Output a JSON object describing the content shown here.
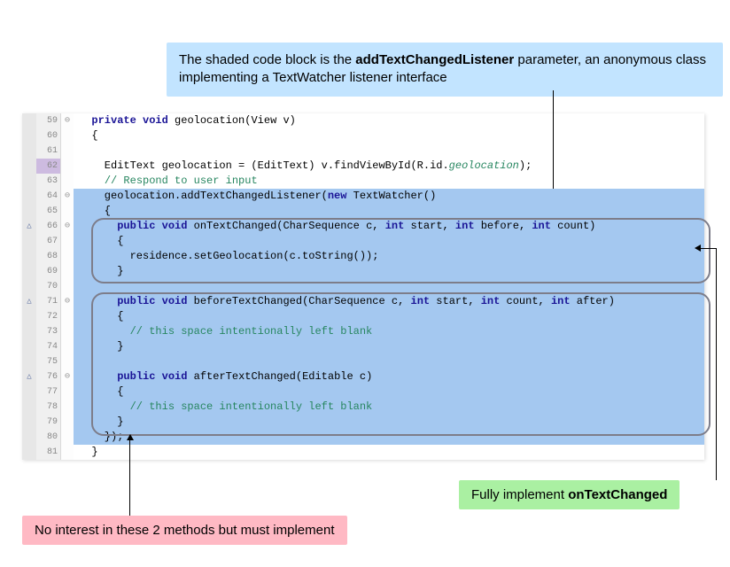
{
  "callout_top": {
    "pre": "The shaded code block is the ",
    "bold": "addTextChangedListener",
    "post": " parameter, an anonymous class implementing a TextWatcher listener interface"
  },
  "callout_green": {
    "pre": "Fully implement ",
    "bold": "onTextChanged"
  },
  "callout_pink": "No interest in these 2 methods but must implement",
  "lines": [
    {
      "num": "59",
      "ga": "",
      "gc": "⊖",
      "shaded": false,
      "hl": false,
      "segs": [
        [
          "",
          "  "
        ],
        [
          "kw",
          "private"
        ],
        [
          "",
          " "
        ],
        [
          "kw",
          "void"
        ],
        [
          "",
          " geolocation(View v)"
        ]
      ]
    },
    {
      "num": "60",
      "ga": "",
      "gc": "",
      "shaded": false,
      "hl": false,
      "segs": [
        [
          "",
          "  {"
        ]
      ]
    },
    {
      "num": "61",
      "ga": "",
      "gc": "",
      "shaded": false,
      "hl": false,
      "segs": [
        [
          "",
          ""
        ]
      ]
    },
    {
      "num": "62",
      "ga": "",
      "gc": "",
      "shaded": false,
      "hl": true,
      "segs": [
        [
          "",
          "    EditText geolocation = (EditText) v.findViewById(R.id."
        ],
        [
          "field",
          "geolocation"
        ],
        [
          "",
          ");"
        ]
      ]
    },
    {
      "num": "63",
      "ga": "",
      "gc": "",
      "shaded": false,
      "hl": false,
      "segs": [
        [
          "",
          "    "
        ],
        [
          "cm",
          "// Respond to user input"
        ]
      ]
    },
    {
      "num": "64",
      "ga": "",
      "gc": "⊖",
      "shaded": true,
      "hl": false,
      "segs": [
        [
          "",
          "    geolocation.addTextChangedListener("
        ],
        [
          "kw",
          "new"
        ],
        [
          "",
          " TextWatcher()"
        ]
      ]
    },
    {
      "num": "65",
      "ga": "",
      "gc": "",
      "shaded": true,
      "hl": false,
      "segs": [
        [
          "",
          "    {"
        ]
      ]
    },
    {
      "num": "66",
      "ga": "△",
      "gc": "⊖",
      "shaded": true,
      "hl": false,
      "segs": [
        [
          "",
          "      "
        ],
        [
          "kw",
          "public"
        ],
        [
          "",
          " "
        ],
        [
          "kw",
          "void"
        ],
        [
          "",
          " onTextChanged(CharSequence c, "
        ],
        [
          "kw",
          "int"
        ],
        [
          "",
          " start, "
        ],
        [
          "kw",
          "int"
        ],
        [
          "",
          " before, "
        ],
        [
          "kw",
          "int"
        ],
        [
          "",
          " count)"
        ]
      ]
    },
    {
      "num": "67",
      "ga": "",
      "gc": "",
      "shaded": true,
      "hl": false,
      "segs": [
        [
          "",
          "      {"
        ]
      ]
    },
    {
      "num": "68",
      "ga": "",
      "gc": "",
      "shaded": true,
      "hl": false,
      "segs": [
        [
          "",
          "        residence.setGeolocation(c.toString());"
        ]
      ]
    },
    {
      "num": "69",
      "ga": "",
      "gc": "",
      "shaded": true,
      "hl": false,
      "segs": [
        [
          "",
          "      }"
        ]
      ]
    },
    {
      "num": "70",
      "ga": "",
      "gc": "",
      "shaded": true,
      "hl": false,
      "segs": [
        [
          "",
          ""
        ]
      ]
    },
    {
      "num": "71",
      "ga": "△",
      "gc": "⊖",
      "shaded": true,
      "hl": false,
      "segs": [
        [
          "",
          "      "
        ],
        [
          "kw",
          "public"
        ],
        [
          "",
          " "
        ],
        [
          "kw",
          "void"
        ],
        [
          "",
          " beforeTextChanged(CharSequence c, "
        ],
        [
          "kw",
          "int"
        ],
        [
          "",
          " start, "
        ],
        [
          "kw",
          "int"
        ],
        [
          "",
          " count, "
        ],
        [
          "kw",
          "int"
        ],
        [
          "",
          " after)"
        ]
      ]
    },
    {
      "num": "72",
      "ga": "",
      "gc": "",
      "shaded": true,
      "hl": false,
      "segs": [
        [
          "",
          "      {"
        ]
      ]
    },
    {
      "num": "73",
      "ga": "",
      "gc": "",
      "shaded": true,
      "hl": false,
      "segs": [
        [
          "",
          "        "
        ],
        [
          "cm",
          "// this space intentionally left blank"
        ]
      ]
    },
    {
      "num": "74",
      "ga": "",
      "gc": "",
      "shaded": true,
      "hl": false,
      "segs": [
        [
          "",
          "      }"
        ]
      ]
    },
    {
      "num": "75",
      "ga": "",
      "gc": "",
      "shaded": true,
      "hl": false,
      "segs": [
        [
          "",
          ""
        ]
      ]
    },
    {
      "num": "76",
      "ga": "△",
      "gc": "⊖",
      "shaded": true,
      "hl": false,
      "segs": [
        [
          "",
          "      "
        ],
        [
          "kw",
          "public"
        ],
        [
          "",
          " "
        ],
        [
          "kw",
          "void"
        ],
        [
          "",
          " afterTextChanged(Editable c)"
        ]
      ]
    },
    {
      "num": "77",
      "ga": "",
      "gc": "",
      "shaded": true,
      "hl": false,
      "segs": [
        [
          "",
          "      {"
        ]
      ]
    },
    {
      "num": "78",
      "ga": "",
      "gc": "",
      "shaded": true,
      "hl": false,
      "segs": [
        [
          "",
          "        "
        ],
        [
          "cm",
          "// this space intentionally left blank"
        ]
      ]
    },
    {
      "num": "79",
      "ga": "",
      "gc": "",
      "shaded": true,
      "hl": false,
      "segs": [
        [
          "",
          "      }"
        ]
      ]
    },
    {
      "num": "80",
      "ga": "",
      "gc": "",
      "shaded": true,
      "hl": false,
      "segs": [
        [
          "",
          "    });"
        ]
      ]
    },
    {
      "num": "81",
      "ga": "",
      "gc": "",
      "shaded": false,
      "hl": false,
      "segs": [
        [
          "",
          "  }"
        ]
      ]
    }
  ]
}
